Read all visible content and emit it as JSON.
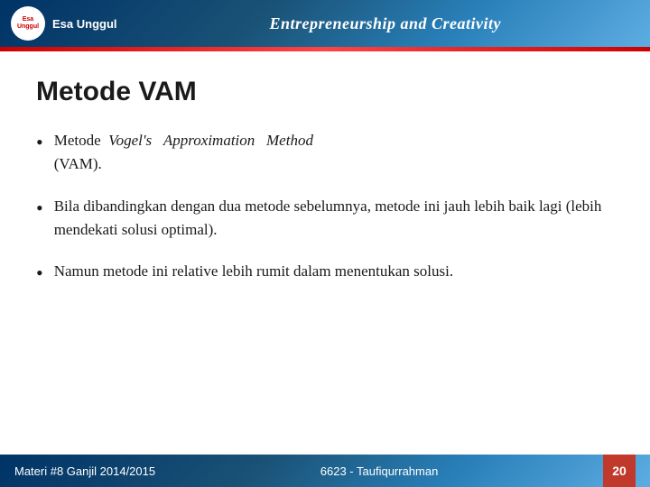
{
  "header": {
    "logo_text": "Esa Unggul",
    "logo_inner_line1": "Esa",
    "logo_inner_line2": "Unggul",
    "title": "Entrepreneurship and Creativity"
  },
  "page": {
    "title": "Metode VAM",
    "bullets": [
      {
        "id": 1,
        "text_normal": "Metode  ",
        "text_italic": "Vogel's   Approximation   Method",
        "text_end": " (VAM)."
      },
      {
        "id": 2,
        "text": "Bila  dibandingkan  dengan  dua  metode sebelumnya, metode ini jauh lebih baik lagi (lebih mendekati solusi optimal)."
      },
      {
        "id": 3,
        "text": "Namun  metode  ini  relative  lebih  rumit dalam menentukan solusi."
      }
    ]
  },
  "footer": {
    "left": "Materi #8 Ganjil 2014/2015",
    "center": "6623 - Taufiqurrahman",
    "page_number": "20"
  }
}
